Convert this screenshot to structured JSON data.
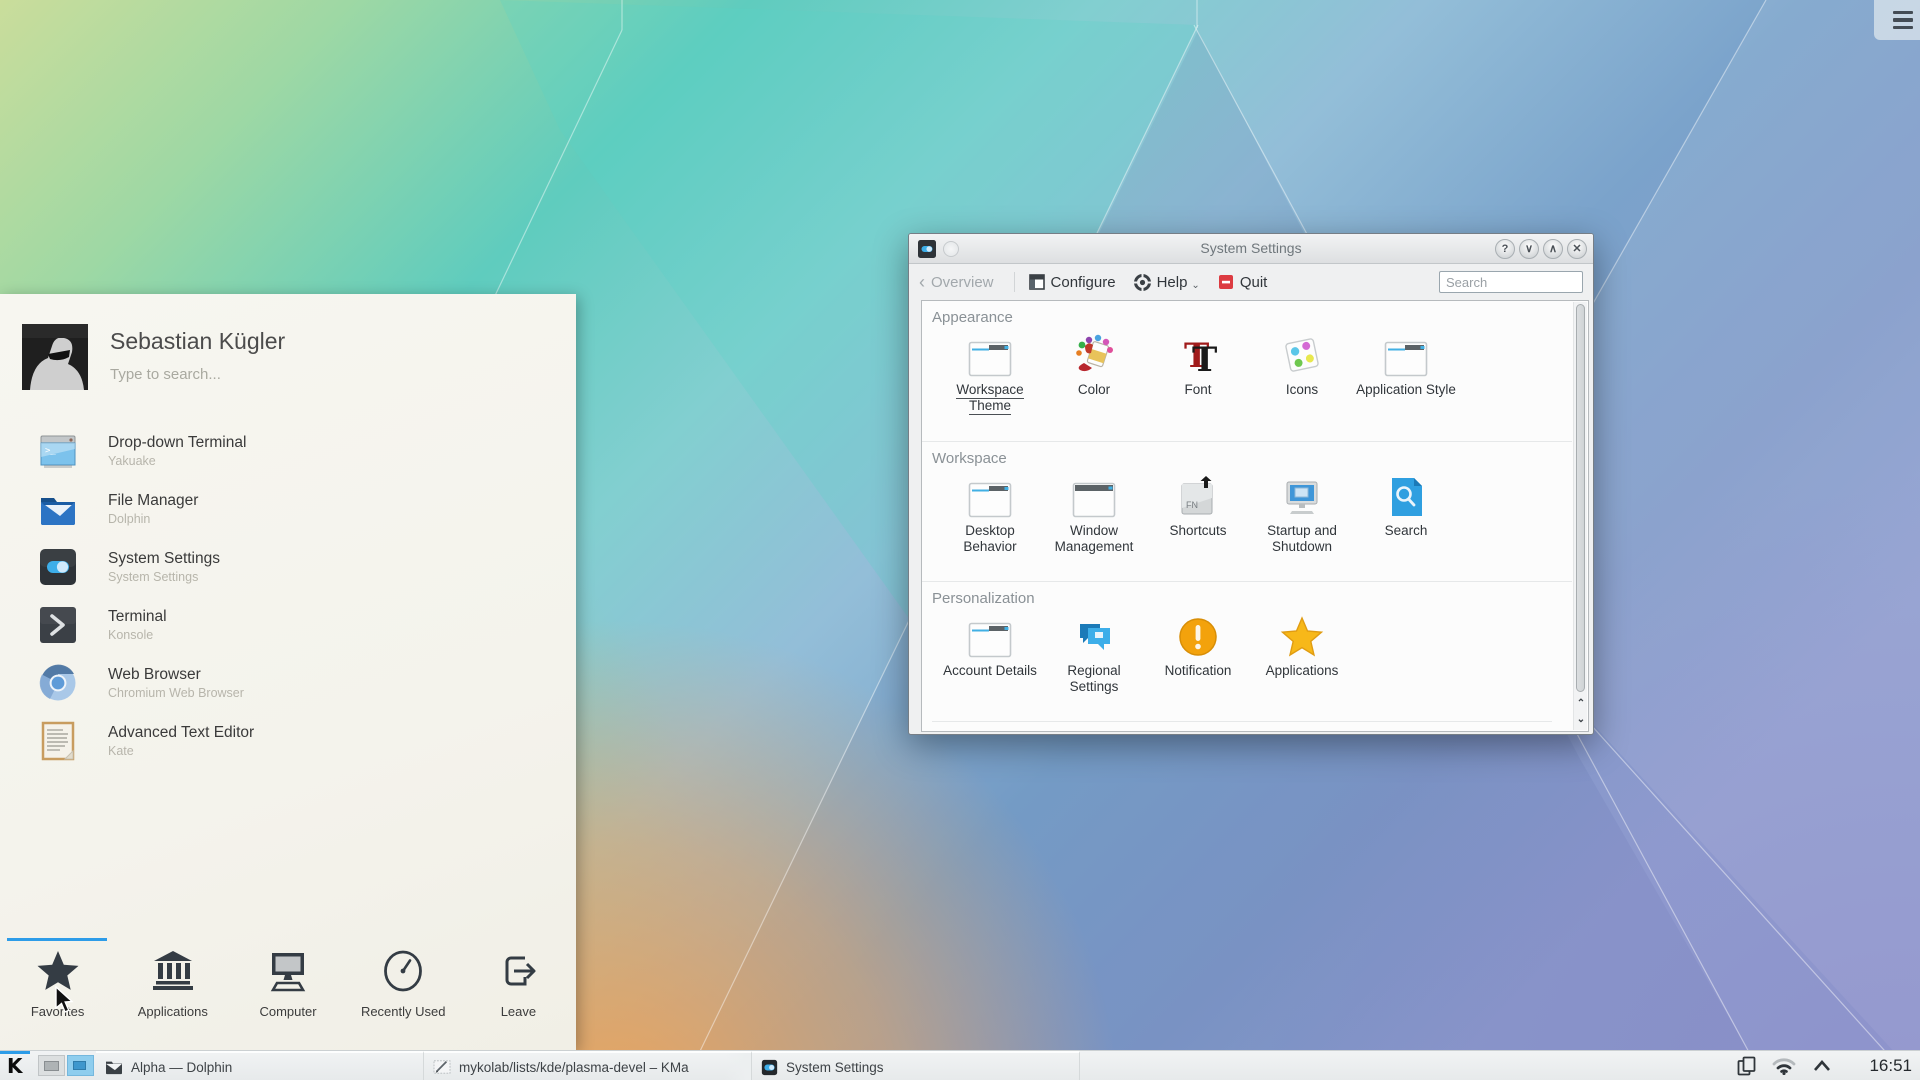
{
  "launcher": {
    "user_name": "Sebastian Kügler",
    "search_hint": "Type to search...",
    "favorites": [
      {
        "title": "Drop-down Terminal",
        "subtitle": "Yakuake",
        "icon": "yakuake-icon"
      },
      {
        "title": "File Manager",
        "subtitle": "Dolphin",
        "icon": "dolphin-icon"
      },
      {
        "title": "System Settings",
        "subtitle": "System Settings",
        "icon": "system-settings-icon"
      },
      {
        "title": "Terminal",
        "subtitle": "Konsole",
        "icon": "konsole-icon"
      },
      {
        "title": "Web Browser",
        "subtitle": "Chromium Web Browser",
        "icon": "chromium-icon"
      },
      {
        "title": "Advanced Text Editor",
        "subtitle": "Kate",
        "icon": "kate-icon"
      }
    ],
    "tabs": [
      {
        "label": "Favorites",
        "icon": "star-icon",
        "active": true
      },
      {
        "label": "Applications",
        "icon": "bank-icon",
        "active": false
      },
      {
        "label": "Computer",
        "icon": "monitor-icon",
        "active": false
      },
      {
        "label": "Recently Used",
        "icon": "gauge-clock-icon",
        "active": false
      },
      {
        "label": "Leave",
        "icon": "exit-icon",
        "active": false
      }
    ]
  },
  "system_settings": {
    "title": "System Settings",
    "toolbar": {
      "back_label": "Overview",
      "configure_label": "Configure",
      "help_label": "Help",
      "quit_label": "Quit",
      "search_placeholder": "Search"
    },
    "sections": [
      {
        "title": "Appearance",
        "items": [
          {
            "label": "Workspace Theme",
            "selected": true,
            "icon": "window-theme-icon"
          },
          {
            "label": "Color",
            "icon": "paint-bucket-icon"
          },
          {
            "label": "Font",
            "icon": "letter-t-icon"
          },
          {
            "label": "Icons",
            "icon": "icons-card-icon"
          },
          {
            "label": "Application Style",
            "icon": "window-theme-icon"
          }
        ]
      },
      {
        "title": "Workspace",
        "items": [
          {
            "label": "Desktop Behavior",
            "icon": "window-theme-icon"
          },
          {
            "label": "Window Management",
            "icon": "window-titlebar-icon"
          },
          {
            "label": "Shortcuts",
            "icon": "fn-key-icon"
          },
          {
            "label": "Startup and Shutdown",
            "icon": "monitor-session-icon"
          },
          {
            "label": "Search",
            "icon": "document-search-icon"
          }
        ]
      },
      {
        "title": "Personalization",
        "items": [
          {
            "label": "Account Details",
            "icon": "window-theme-icon"
          },
          {
            "label": "Regional Settings",
            "icon": "speech-bubbles-icon"
          },
          {
            "label": "Notification",
            "icon": "exclamation-circle-icon"
          },
          {
            "label": "Applications",
            "icon": "star-orange-icon"
          }
        ]
      }
    ]
  },
  "taskbar": {
    "tasks": [
      {
        "label": "Alpha — Dolphin",
        "icon": "dolphin-icon"
      },
      {
        "label": "mykolab/lists/kde/plasma-devel – KMa",
        "icon": "kmail-icon"
      },
      {
        "label": "System Settings",
        "icon": "system-settings-icon"
      }
    ],
    "clock": "16:51"
  },
  "colors": {
    "accent_blue": "#2d9ce8",
    "toggle_blue": "#3daee9",
    "quit_red": "#dc3b41",
    "notification_orange": "#f3a20c",
    "star_yellow": "#f7b819"
  }
}
